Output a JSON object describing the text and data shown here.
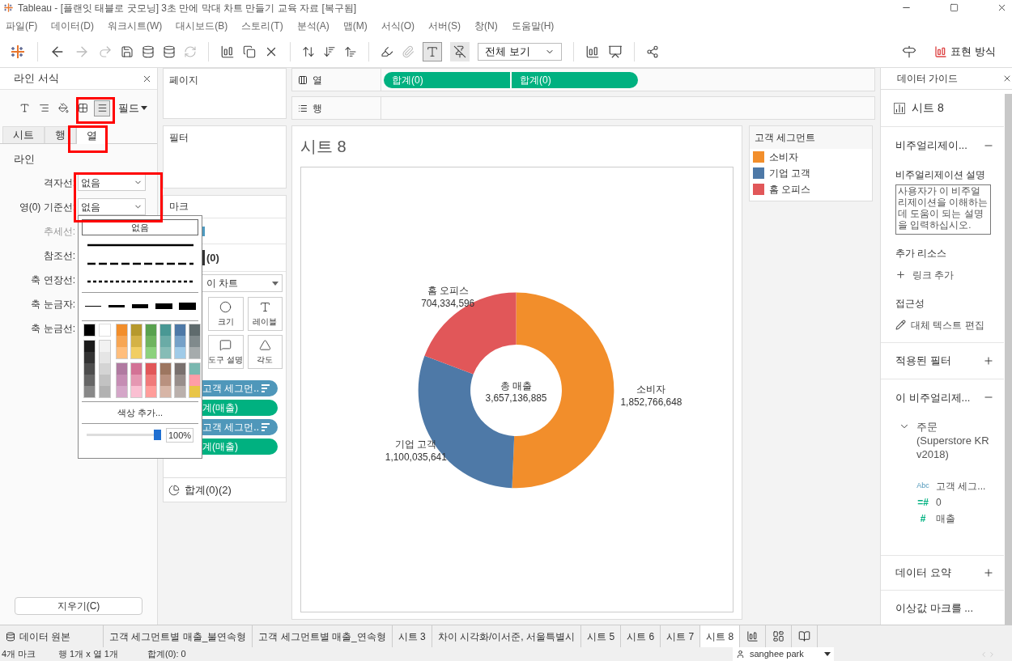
{
  "window": {
    "title": "Tableau - [플랜잇 태블로 굿모닝] 3초 만에 막대 차트 만들기 교육 자료 [복구됨]"
  },
  "menu": [
    "파일(F)",
    "데이터(D)",
    "워크시트(W)",
    "대시보드(B)",
    "스토리(T)",
    "분석(A)",
    "맵(M)",
    "서식(O)",
    "서버(S)",
    "창(N)",
    "도움말(H)"
  ],
  "toolbar": {
    "view_select": "전체 보기",
    "show_me": "표현 방식"
  },
  "format_pane": {
    "title": "라인 서식",
    "field_menu": "필드",
    "icons": [
      {
        "kind": "font",
        "selected": false
      },
      {
        "kind": "align",
        "selected": false
      },
      {
        "kind": "shading",
        "selected": false
      },
      {
        "kind": "borders",
        "selected": false
      },
      {
        "kind": "lines",
        "selected": true
      }
    ],
    "tabs": [
      {
        "label": "시트",
        "selected": false
      },
      {
        "label": "행",
        "selected": false
      },
      {
        "label": "열",
        "selected": true
      }
    ],
    "section": "라인",
    "rows": [
      {
        "label": "격자선:",
        "kind": "select",
        "value": "없음",
        "disabled": false
      },
      {
        "label": "영(0) 기준선:",
        "kind": "select",
        "value": "없음",
        "disabled": false
      },
      {
        "label": "추세선:",
        "kind": "label",
        "disabled": true
      },
      {
        "label": "참조선:",
        "kind": "label",
        "disabled": false
      },
      {
        "label": "축 연장선:",
        "kind": "label",
        "disabled": false
      },
      {
        "label": "축 눈금자:",
        "kind": "label",
        "disabled": false
      },
      {
        "label": "축 눈금선:",
        "kind": "label",
        "disabled": false
      }
    ],
    "clear_button": "지우기(C)"
  },
  "line_popup": {
    "none_option": "없음",
    "none_selected": true,
    "add_color": "색상 추가...",
    "opacity": {
      "level": 1,
      "reading": "100%"
    },
    "single": [
      {
        "color": "#000000"
      },
      {
        "color": "#ffffff"
      }
    ],
    "gray_columns": [
      {
        "swatches": [
          {
            "color": "#1b1b1b"
          },
          {
            "color": "#333333"
          },
          {
            "color": "#4d4d4d"
          },
          {
            "color": "#666666"
          },
          {
            "color": "#888888"
          }
        ]
      },
      {
        "swatches": [
          {
            "color": "#f2f2f2"
          },
          {
            "color": "#e5e5e5"
          },
          {
            "color": "#d4d4d4"
          },
          {
            "color": "#c2c2c2"
          },
          {
            "color": "#b2b2b2"
          }
        ]
      }
    ],
    "top_columns": [
      {
        "swatches": [
          {
            "color": "#f28e2b"
          },
          {
            "color": "#f7a654"
          },
          {
            "color": "#ffbe7d"
          }
        ]
      },
      {
        "swatches": [
          {
            "color": "#b6992d"
          },
          {
            "color": "#d4b246"
          },
          {
            "color": "#f1ce63"
          }
        ]
      },
      {
        "swatches": [
          {
            "color": "#59a14f"
          },
          {
            "color": "#6fb45f"
          },
          {
            "color": "#8cd17d"
          }
        ]
      },
      {
        "swatches": [
          {
            "color": "#499894"
          },
          {
            "color": "#6aaba6"
          },
          {
            "color": "#86bcb6"
          }
        ]
      },
      {
        "swatches": [
          {
            "color": "#4e79a7"
          },
          {
            "color": "#76a1c8"
          },
          {
            "color": "#a0cbe8"
          }
        ]
      },
      {
        "swatches": [
          {
            "color": "#5f6b6d"
          },
          {
            "color": "#808a8c"
          },
          {
            "color": "#a5abac"
          }
        ]
      }
    ],
    "bottom_columns": [
      {
        "swatches": [
          {
            "color": "#b07aa1"
          },
          {
            "color": "#c58db4"
          },
          {
            "color": "#d4a6c8"
          }
        ]
      },
      {
        "swatches": [
          {
            "color": "#d37295"
          },
          {
            "color": "#e597b2"
          },
          {
            "color": "#fabfd2"
          }
        ]
      },
      {
        "swatches": [
          {
            "color": "#e15759"
          },
          {
            "color": "#f07a7a"
          },
          {
            "color": "#ff9d9a"
          }
        ]
      },
      {
        "swatches": [
          {
            "color": "#9d7660"
          },
          {
            "color": "#b9917f"
          },
          {
            "color": "#d7b5a6"
          }
        ]
      },
      {
        "swatches": [
          {
            "color": "#79706e"
          },
          {
            "color": "#988e8b"
          },
          {
            "color": "#bab0ac"
          }
        ]
      },
      {
        "swatches": [
          {
            "color": "#7ab8b0"
          },
          {
            "color": "#ff9da7"
          },
          {
            "color": "#e8c547"
          }
        ]
      }
    ]
  },
  "cards": {
    "pages": "페이지",
    "filters": "필터",
    "marks": {
      "title": "마크",
      "tab": "(0)",
      "mark_type": "이 차트",
      "buttons": [
        "크기",
        "레이블",
        "도구 설명",
        "각도"
      ],
      "pills": [
        {
          "text": "고객 세그먼..",
          "kind": "dimension"
        },
        {
          "text": "계(매출)",
          "kind": "measure"
        },
        {
          "text": "고객 세그먼..",
          "kind": "dimension"
        },
        {
          "text": "계(매출)",
          "kind": "measure"
        }
      ],
      "footer": "합계(0)(2)"
    }
  },
  "columns_shelf": {
    "label": "열",
    "pills": [
      "합계(0)",
      "합계(0)"
    ]
  },
  "rows_shelf": {
    "label": "행"
  },
  "sheet": {
    "title": "시트 8",
    "center_label": "총 매출",
    "center_value": "3,657,136,885",
    "chart_data": {
      "type": "donut",
      "categories": [
        "소비자",
        "기업 고객",
        "홈 오피스"
      ],
      "values": [
        1852766648,
        1100035641,
        704334596
      ],
      "value_labels": [
        "1,852,766,648",
        "1,100,035,641",
        "704,334,596"
      ]
    }
  },
  "legend": {
    "title": "고객 세그먼트",
    "items": [
      {
        "label": "소비자",
        "color": "#f28e2b"
      },
      {
        "label": "기업 고객",
        "color": "#4e79a7"
      },
      {
        "label": "홈 오피스",
        "color": "#e15759"
      }
    ]
  },
  "data_guide": {
    "title": "데이터 가이드",
    "sheet": "시트 8",
    "viz_section": {
      "title": "비주얼리제이...",
      "expanded": true,
      "description_label": "비주얼리제이션 설명",
      "description_placeholder": "사용자가 이 비주얼리제이션을 이해하는 데 도움이 되는 설명을 입력하십시오.",
      "resources_label": "추가 리소스",
      "add_link": "링크 추가",
      "accessibility_label": "접근성",
      "edit_alt": "대체 텍스트 편집"
    },
    "filters_section": {
      "title": "적용된 필터",
      "expanded": false
    },
    "fields_section": {
      "title": "이 비주얼리제...",
      "expanded": true,
      "source": {
        "name": "주문 (Superstore KR v2018)",
        "expanded": true,
        "children": [
          {
            "type": "Abc",
            "name": "고객 세그..."
          },
          {
            "type": "=#",
            "name": "0"
          },
          {
            "type": "#",
            "name": "매출"
          }
        ]
      }
    },
    "summary_section": {
      "title": "데이터 요약",
      "expanded": false
    },
    "outlier_section": {
      "title": "이상값 마크를 ..."
    }
  },
  "sheet_tabs": [
    {
      "label": "데이터 원본",
      "kind": "data-source",
      "selected": false
    },
    {
      "label": "고객 세그먼트별 매출_불연속형",
      "kind": "sheet",
      "selected": false
    },
    {
      "label": "고객 세그먼트별 매출_연속형",
      "kind": "sheet",
      "selected": false
    },
    {
      "label": "시트 3",
      "kind": "sheet",
      "selected": false
    },
    {
      "label": "차이 시각화/이서준, 서울특별시",
      "kind": "sheet",
      "selected": false
    },
    {
      "label": "시트 5",
      "kind": "sheet",
      "selected": false
    },
    {
      "label": "시트 6",
      "kind": "sheet",
      "selected": false
    },
    {
      "label": "시트 7",
      "kind": "sheet",
      "selected": false
    },
    {
      "label": "시트 8",
      "kind": "sheet",
      "selected": true
    }
  ],
  "status_bar": {
    "marks": "4개 마크",
    "dims": "행 1개 x 열 1개",
    "sum": "합계(0): 0",
    "user": "sanghee park"
  }
}
